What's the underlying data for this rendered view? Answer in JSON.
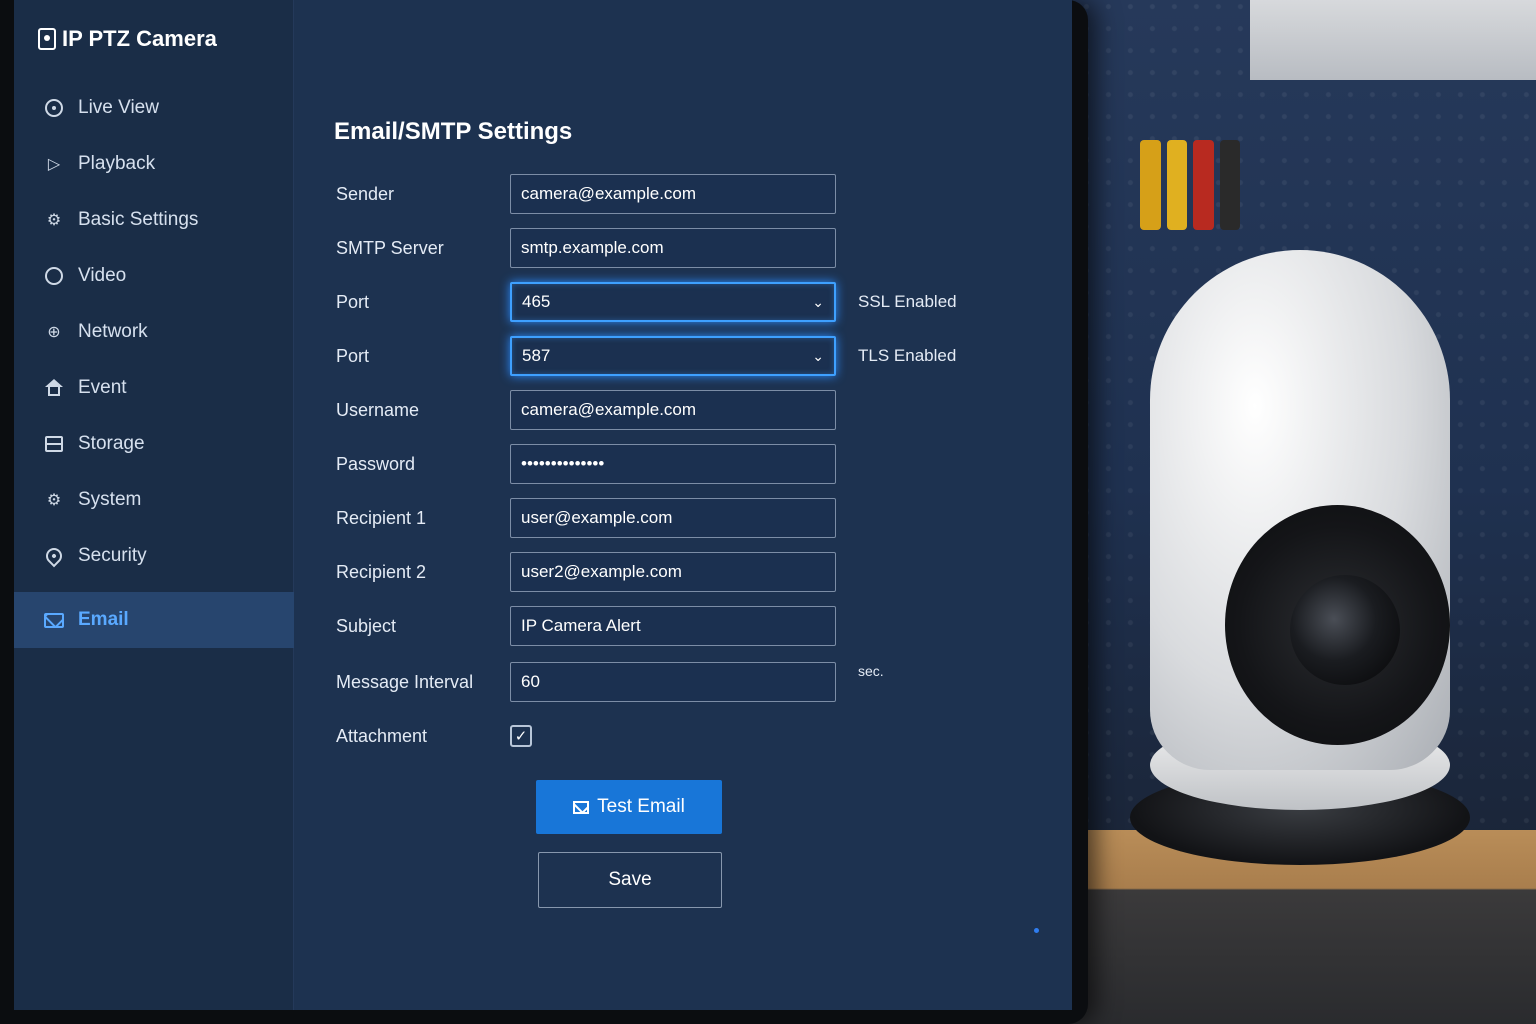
{
  "app": {
    "title": "IP PTZ Camera"
  },
  "sidebar": {
    "items": [
      {
        "label": "Live View",
        "icon": "live-view-icon"
      },
      {
        "label": "Playback",
        "icon": "playback-icon"
      },
      {
        "label": "Basic Settings",
        "icon": "gear-icon"
      },
      {
        "label": "Video",
        "icon": "video-icon"
      },
      {
        "label": "Network",
        "icon": "globe-icon"
      },
      {
        "label": "Event",
        "icon": "home-icon"
      },
      {
        "label": "Storage",
        "icon": "storage-icon"
      },
      {
        "label": "System",
        "icon": "gear-icon"
      },
      {
        "label": "Security",
        "icon": "location-pin-icon"
      },
      {
        "label": "Email",
        "icon": "mail-icon",
        "active": true
      }
    ]
  },
  "page": {
    "title": "Email/SMTP Settings"
  },
  "form": {
    "sender": {
      "label": "Sender",
      "value": "camera@example.com"
    },
    "smtp_server": {
      "label": "SMTP Server",
      "value": "smtp.example.com"
    },
    "port_ssl": {
      "label": "Port",
      "value": "465",
      "note": "SSL Enabled"
    },
    "port_tls": {
      "label": "Port",
      "value": "587",
      "note": "TLS Enabled"
    },
    "username": {
      "label": "Username",
      "value": "camera@example.com"
    },
    "password": {
      "label": "Password",
      "value": "••••••••••••••"
    },
    "recipient1": {
      "label": "Recipient 1",
      "value": "user@example.com"
    },
    "recipient2": {
      "label": "Recipient 2",
      "value": "user2@example.com"
    },
    "subject": {
      "label": "Subject",
      "value": "IP Camera Alert"
    },
    "interval": {
      "label": "Message Interval",
      "value": "60",
      "unit": "sec."
    },
    "attachment": {
      "label": "Attachment",
      "checked": true,
      "check_glyph": "✓"
    }
  },
  "buttons": {
    "test_email": "Test Email",
    "save": "Save"
  },
  "colors": {
    "accent": "#1876d8",
    "focus_glow": "#3ea0ff",
    "active_nav": "#5aa9ff",
    "panel": "#1d3250"
  },
  "glyphs": {
    "chevron": "⌄"
  }
}
